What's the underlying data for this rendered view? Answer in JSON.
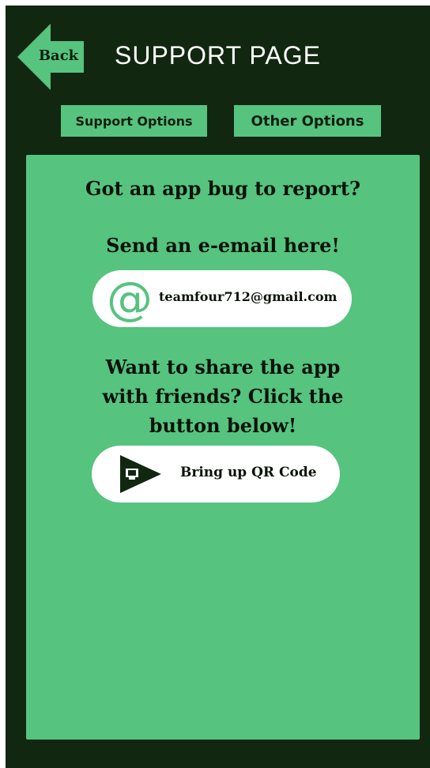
{
  "header": {
    "back_label": "Back",
    "title": "SUPPORT PAGE"
  },
  "tabs": [
    {
      "label": "Support Options"
    },
    {
      "label": "Other Options"
    }
  ],
  "panel": {
    "bug_heading": "Got an app bug to report?",
    "email_heading": "Send an e-email here!",
    "email_icon": "@",
    "email_address": "teamfour712@gmail.com",
    "share_heading_line1": "Want to share the app",
    "share_heading_line2": "with friends? Click the",
    "share_heading_line3": "button below!",
    "qr_button_label": "Bring up QR Code"
  },
  "icons": {
    "back": "arrow-left-icon",
    "email": "at-sign-icon",
    "qr": "share-play-icon"
  },
  "colors": {
    "background": "#112710",
    "accent": "#56c37f",
    "text_dark": "#0a1208",
    "title_text": "#ffffff",
    "pill": "#ffffff"
  }
}
